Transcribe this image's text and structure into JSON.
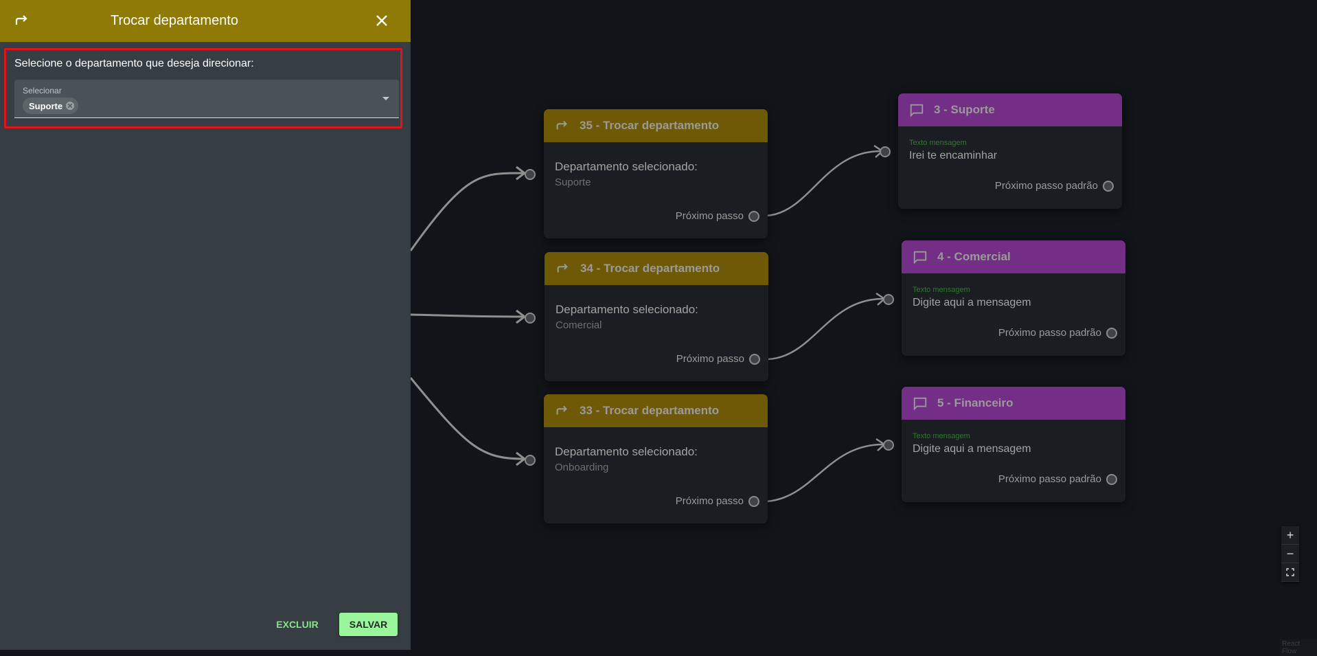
{
  "panel": {
    "title": "Trocar departamento",
    "question": "Selecione o departamento que deseja direcionar:",
    "select_label": "Selecionar",
    "selected_chip": "Suporte",
    "delete_label": "EXCLUIR",
    "save_label": "SALVAR",
    "header_icon": "redirect-arrow-icon",
    "close_icon": "close-icon",
    "header_color": "#8e7a04"
  },
  "switch_nodes": [
    {
      "title": "35 - Trocar departamento",
      "label": "Departamento selecionado:",
      "value": "Suporte",
      "next": "Próximo passo"
    },
    {
      "title": "34 - Trocar departamento",
      "label": "Departamento selecionado:",
      "value": "Comercial",
      "next": "Próximo passo"
    },
    {
      "title": "33 - Trocar departamento",
      "label": "Departamento selecionado:",
      "value": "Onboarding",
      "next": "Próximo passo"
    }
  ],
  "message_nodes": [
    {
      "title": "3 - Suporte",
      "field_label": "Texto mensagem",
      "text": "Irei te encaminhar",
      "next": "Próximo passo padrão"
    },
    {
      "title": "4 - Comercial",
      "field_label": "Texto mensagem",
      "text": "Digite aqui a mensagem",
      "next": "Próximo passo padrão"
    },
    {
      "title": "5 - Financeiro",
      "field_label": "Texto mensagem",
      "text": "Digite aqui a mensagem",
      "next": "Próximo passo padrão"
    }
  ],
  "zoom": {
    "in": "+",
    "out": "−",
    "fit": "fit-view-icon"
  },
  "attribution": "React Flow",
  "colors": {
    "switch_header": "#6e5a06",
    "message_header": "#732f86",
    "save_button": "#9af59d"
  }
}
